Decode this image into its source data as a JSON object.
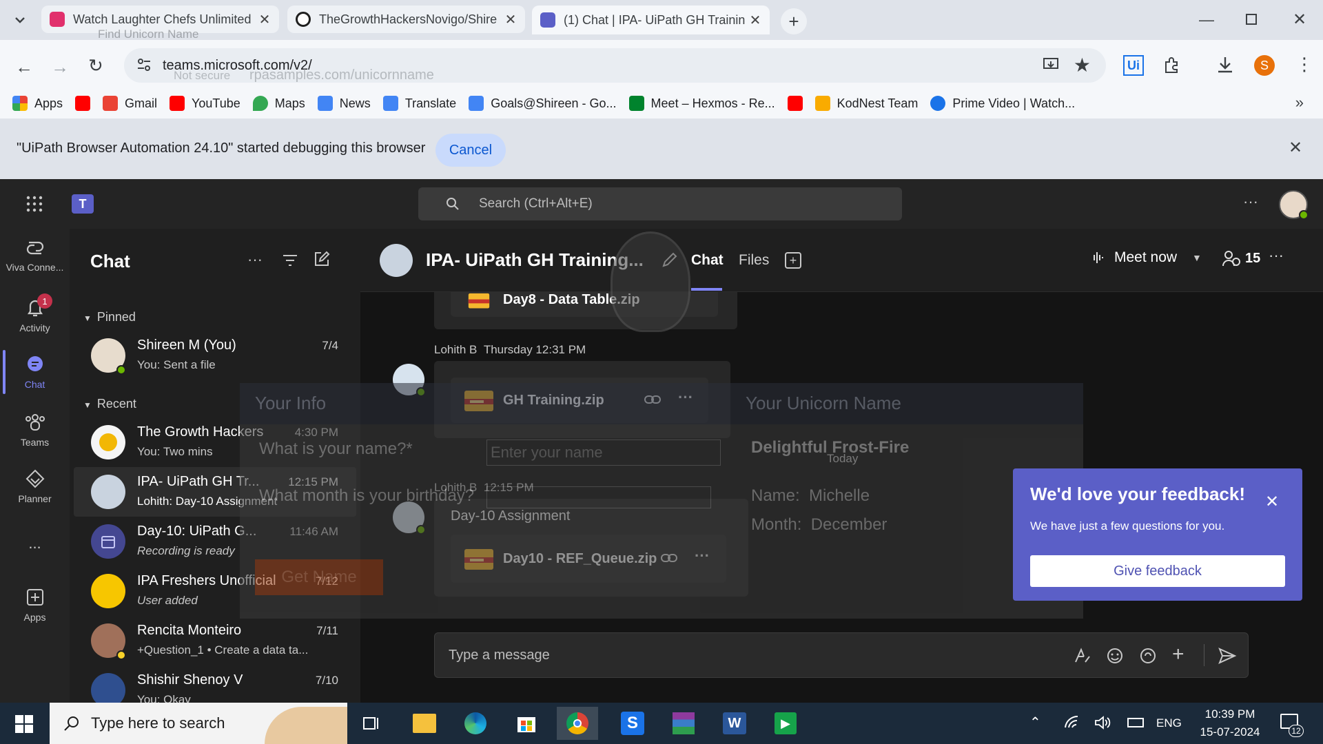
{
  "browser": {
    "tabs": [
      {
        "title": "Watch Laughter Chefs Unlimited",
        "favicon_color": "#e1306c",
        "active": false
      },
      {
        "title": "TheGrowthHackersNovigo/Shire",
        "favicon_color": "#1f1f1f",
        "active": false
      },
      {
        "title": "(1) Chat | IPA- UiPath GH Trainin",
        "favicon_color": "#5b5fc7",
        "active": true
      }
    ],
    "url": "teams.microsoft.com/v2/",
    "profile_letter": "S",
    "bookmarks": [
      "Apps",
      "",
      "Gmail",
      "YouTube",
      "Maps",
      "News",
      "Translate",
      "Goals@Shireen - Go...",
      "Meet – Hexmos - Re...",
      "",
      "KodNest Team",
      "Prime Video | Watch..."
    ],
    "infobar": {
      "message": "\"UiPath Browser Automation 24.10\" started debugging this browser",
      "cancel_label": "Cancel"
    }
  },
  "teams": {
    "search_placeholder": "Search (Ctrl+Alt+E)",
    "rail": [
      {
        "label": "Viva Conne...",
        "icon": "viva-connections-icon"
      },
      {
        "label": "Activity",
        "icon": "bell-icon",
        "badge": "1"
      },
      {
        "label": "Chat",
        "icon": "chat-icon",
        "active": true
      },
      {
        "label": "Teams",
        "icon": "teams-icon"
      },
      {
        "label": "Planner",
        "icon": "planner-icon"
      },
      {
        "label": "...",
        "icon": "more-icon"
      },
      {
        "label": "Apps",
        "icon": "apps-icon"
      }
    ],
    "chat_panel": {
      "title": "Chat",
      "pinned_label": "Pinned",
      "recent_label": "Recent",
      "pinned": [
        {
          "name": "Shireen M (You)",
          "preview": "You: Sent a file",
          "time": "7/4"
        }
      ],
      "recent": [
        {
          "name": "The Growth Hackers",
          "preview": "You: Two mins",
          "time": "4:30 PM"
        },
        {
          "name": "IPA- UiPath GH Tr...",
          "preview": "Lohith: Day-10 Assignment",
          "time": "12:15 PM",
          "selected": true
        },
        {
          "name": "Day-10: UiPath G...",
          "preview": "Recording is ready",
          "time": "11:46 AM"
        },
        {
          "name": "IPA Freshers Unofficial",
          "preview": "User added",
          "time": "7/12"
        },
        {
          "name": "Rencita Monteiro",
          "preview": "+Question_1  • Create a data ta...",
          "time": "7/11"
        },
        {
          "name": "Shishir Shenoy V",
          "preview": "You: Okay",
          "time": "7/10"
        }
      ]
    },
    "conversation": {
      "title": "IPA- UiPath GH Training...",
      "tabs": [
        "Chat",
        "Files"
      ],
      "meet_now": "Meet now",
      "participants": "15",
      "messages": [
        {
          "file": "Day8 - Data Table.zip"
        },
        {
          "sender": "Lohith B",
          "time": "Thursday 12:31 PM",
          "file": "GH Training.zip"
        },
        {
          "date_divider": "Today"
        },
        {
          "sender": "Lohith B",
          "time": "12:15 PM",
          "text": "Day-10 Assignment",
          "file": "Day10 - REF_Queue.zip"
        }
      ],
      "composer_placeholder": "Type a message"
    },
    "feedback": {
      "heading": "We'd love your feedback!",
      "subtext": "We have just a few questions for you.",
      "button": "Give feedback"
    }
  },
  "overlay_page": {
    "url": "rpasamples.com/unicornname",
    "not_secure": "Not secure",
    "tab_title": "Find Unicorn Name",
    "left_header": "Your Info",
    "right_header": "Your Unicorn Name",
    "q1": "What is your name?*",
    "q1_placeholder": "Enter your name",
    "q2": "What month is your birthday?",
    "button": "Get Name",
    "result_title": "Delightful Frost-Fire",
    "result_name_label": "Name:",
    "result_name": "Michelle",
    "result_month_label": "Month:",
    "result_month": "December"
  },
  "taskbar": {
    "search_placeholder": "Type here to search",
    "language": "ENG",
    "time": "10:39 PM",
    "date": "15-07-2024",
    "notifications": "12"
  }
}
